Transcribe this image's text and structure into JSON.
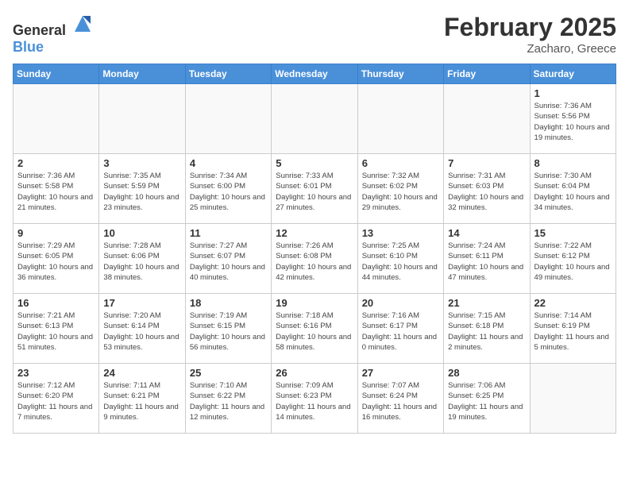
{
  "header": {
    "logo_general": "General",
    "logo_blue": "Blue",
    "title": "February 2025",
    "subtitle": "Zacharo, Greece"
  },
  "days_of_week": [
    "Sunday",
    "Monday",
    "Tuesday",
    "Wednesday",
    "Thursday",
    "Friday",
    "Saturday"
  ],
  "weeks": [
    [
      {
        "day": "",
        "info": ""
      },
      {
        "day": "",
        "info": ""
      },
      {
        "day": "",
        "info": ""
      },
      {
        "day": "",
        "info": ""
      },
      {
        "day": "",
        "info": ""
      },
      {
        "day": "",
        "info": ""
      },
      {
        "day": "1",
        "info": "Sunrise: 7:36 AM\nSunset: 5:56 PM\nDaylight: 10 hours and 19 minutes."
      }
    ],
    [
      {
        "day": "2",
        "info": "Sunrise: 7:36 AM\nSunset: 5:58 PM\nDaylight: 10 hours and 21 minutes."
      },
      {
        "day": "3",
        "info": "Sunrise: 7:35 AM\nSunset: 5:59 PM\nDaylight: 10 hours and 23 minutes."
      },
      {
        "day": "4",
        "info": "Sunrise: 7:34 AM\nSunset: 6:00 PM\nDaylight: 10 hours and 25 minutes."
      },
      {
        "day": "5",
        "info": "Sunrise: 7:33 AM\nSunset: 6:01 PM\nDaylight: 10 hours and 27 minutes."
      },
      {
        "day": "6",
        "info": "Sunrise: 7:32 AM\nSunset: 6:02 PM\nDaylight: 10 hours and 29 minutes."
      },
      {
        "day": "7",
        "info": "Sunrise: 7:31 AM\nSunset: 6:03 PM\nDaylight: 10 hours and 32 minutes."
      },
      {
        "day": "8",
        "info": "Sunrise: 7:30 AM\nSunset: 6:04 PM\nDaylight: 10 hours and 34 minutes."
      }
    ],
    [
      {
        "day": "9",
        "info": "Sunrise: 7:29 AM\nSunset: 6:05 PM\nDaylight: 10 hours and 36 minutes."
      },
      {
        "day": "10",
        "info": "Sunrise: 7:28 AM\nSunset: 6:06 PM\nDaylight: 10 hours and 38 minutes."
      },
      {
        "day": "11",
        "info": "Sunrise: 7:27 AM\nSunset: 6:07 PM\nDaylight: 10 hours and 40 minutes."
      },
      {
        "day": "12",
        "info": "Sunrise: 7:26 AM\nSunset: 6:08 PM\nDaylight: 10 hours and 42 minutes."
      },
      {
        "day": "13",
        "info": "Sunrise: 7:25 AM\nSunset: 6:10 PM\nDaylight: 10 hours and 44 minutes."
      },
      {
        "day": "14",
        "info": "Sunrise: 7:24 AM\nSunset: 6:11 PM\nDaylight: 10 hours and 47 minutes."
      },
      {
        "day": "15",
        "info": "Sunrise: 7:22 AM\nSunset: 6:12 PM\nDaylight: 10 hours and 49 minutes."
      }
    ],
    [
      {
        "day": "16",
        "info": "Sunrise: 7:21 AM\nSunset: 6:13 PM\nDaylight: 10 hours and 51 minutes."
      },
      {
        "day": "17",
        "info": "Sunrise: 7:20 AM\nSunset: 6:14 PM\nDaylight: 10 hours and 53 minutes."
      },
      {
        "day": "18",
        "info": "Sunrise: 7:19 AM\nSunset: 6:15 PM\nDaylight: 10 hours and 56 minutes."
      },
      {
        "day": "19",
        "info": "Sunrise: 7:18 AM\nSunset: 6:16 PM\nDaylight: 10 hours and 58 minutes."
      },
      {
        "day": "20",
        "info": "Sunrise: 7:16 AM\nSunset: 6:17 PM\nDaylight: 11 hours and 0 minutes."
      },
      {
        "day": "21",
        "info": "Sunrise: 7:15 AM\nSunset: 6:18 PM\nDaylight: 11 hours and 2 minutes."
      },
      {
        "day": "22",
        "info": "Sunrise: 7:14 AM\nSunset: 6:19 PM\nDaylight: 11 hours and 5 minutes."
      }
    ],
    [
      {
        "day": "23",
        "info": "Sunrise: 7:12 AM\nSunset: 6:20 PM\nDaylight: 11 hours and 7 minutes."
      },
      {
        "day": "24",
        "info": "Sunrise: 7:11 AM\nSunset: 6:21 PM\nDaylight: 11 hours and 9 minutes."
      },
      {
        "day": "25",
        "info": "Sunrise: 7:10 AM\nSunset: 6:22 PM\nDaylight: 11 hours and 12 minutes."
      },
      {
        "day": "26",
        "info": "Sunrise: 7:09 AM\nSunset: 6:23 PM\nDaylight: 11 hours and 14 minutes."
      },
      {
        "day": "27",
        "info": "Sunrise: 7:07 AM\nSunset: 6:24 PM\nDaylight: 11 hours and 16 minutes."
      },
      {
        "day": "28",
        "info": "Sunrise: 7:06 AM\nSunset: 6:25 PM\nDaylight: 11 hours and 19 minutes."
      },
      {
        "day": "",
        "info": ""
      }
    ]
  ]
}
